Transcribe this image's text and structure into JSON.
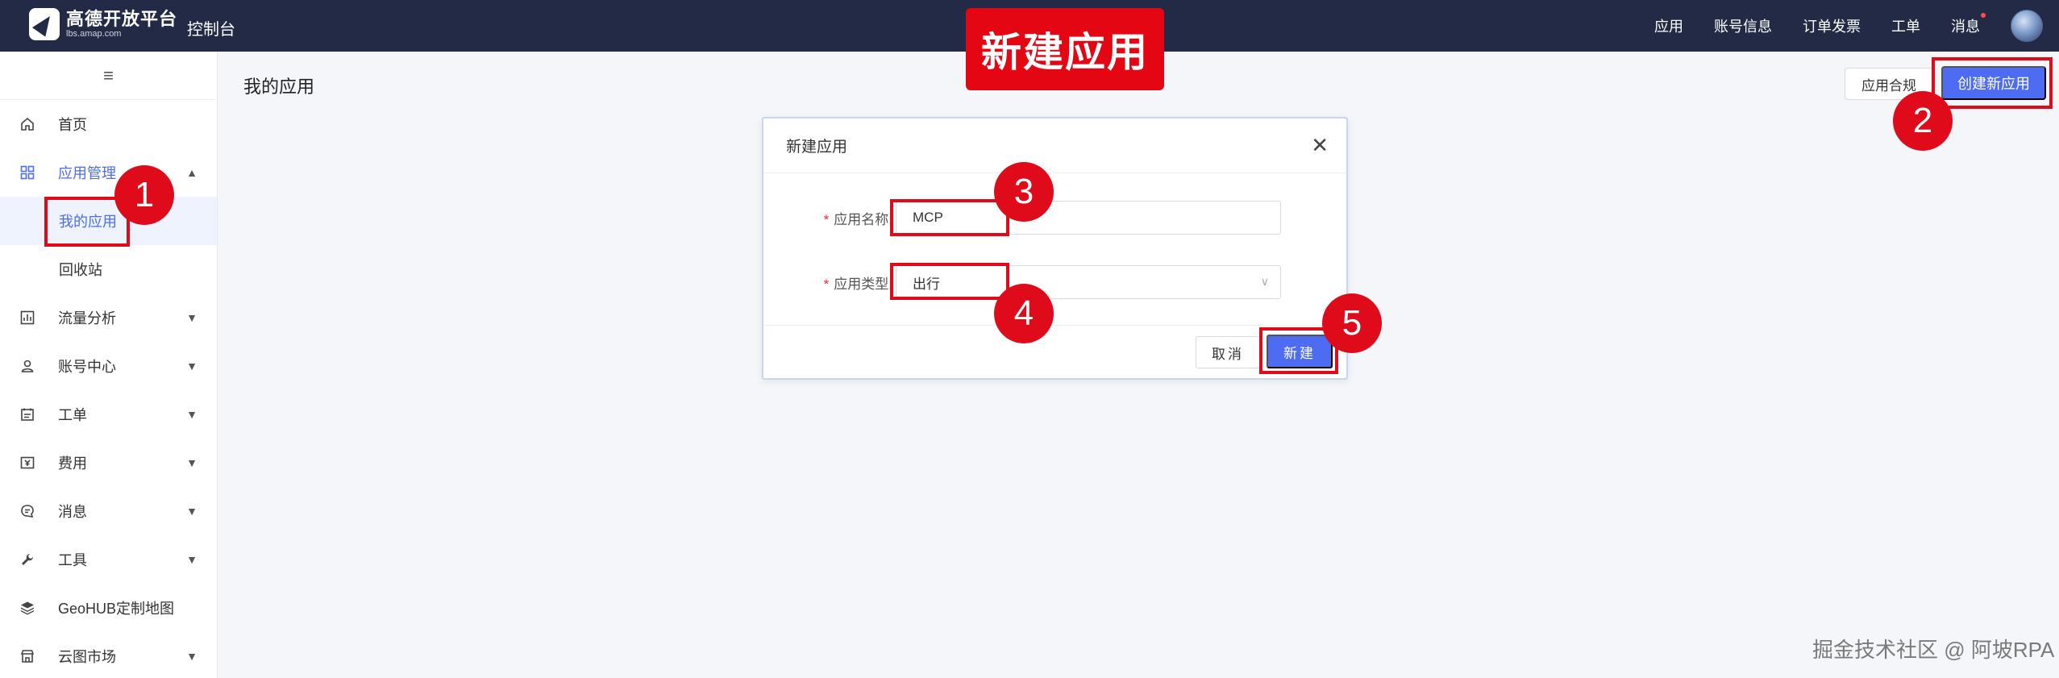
{
  "topbar": {
    "logo_name": "高德开放平台",
    "logo_site": "lbs.amap.com",
    "console": "控制台",
    "nav": [
      "应用",
      "账号信息",
      "订单发票",
      "工单",
      "消息"
    ]
  },
  "sidebar": {
    "collapse_icon": "≡",
    "items": [
      {
        "label": "首页",
        "icon": "home-icon"
      },
      {
        "label": "应用管理",
        "icon": "apps-grid-icon"
      },
      {
        "label": "流量分析",
        "icon": "chart-icon"
      },
      {
        "label": "账号中心",
        "icon": "user-icon"
      },
      {
        "label": "工单",
        "icon": "ticket-icon"
      },
      {
        "label": "费用",
        "icon": "fee-icon"
      },
      {
        "label": "消息",
        "icon": "message-icon"
      },
      {
        "label": "工具",
        "icon": "wrench-icon"
      },
      {
        "label": "GeoHUB定制地图",
        "icon": "layers-icon"
      },
      {
        "label": "云图市场",
        "icon": "store-icon"
      }
    ],
    "sub_items": [
      "我的应用",
      "回收站"
    ]
  },
  "main": {
    "page_title": "我的应用",
    "compliance_button": "应用合规",
    "create_button": "创建新应用"
  },
  "banner": "新建应用",
  "dialog": {
    "title": "新建应用",
    "name_label": "应用名称:",
    "name_value": "MCP",
    "type_label": "应用类型:",
    "type_value": "出行",
    "cancel": "取消",
    "confirm": "新建"
  },
  "annotations": [
    "1",
    "2",
    "3",
    "4",
    "5"
  ],
  "watermark": "掘金技术社区 @ 阿坡RPA",
  "colors": {
    "topbar": "#232a45",
    "primary": "#4d6cf2",
    "annotation": "#e00b1a"
  }
}
